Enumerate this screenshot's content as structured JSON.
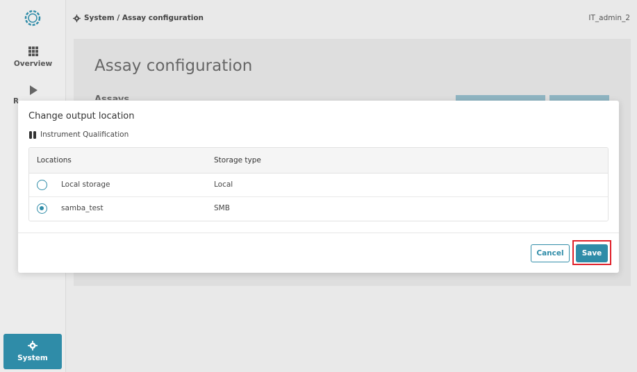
{
  "sidebar": {
    "items": [
      {
        "label": "Overview",
        "icon": "grid-icon"
      },
      {
        "label": "R",
        "icon": "play-icon"
      },
      {
        "label": "System",
        "icon": "gear-icon"
      }
    ]
  },
  "header": {
    "breadcrumb": "System / Assay configuration",
    "user": "IT_admin_2"
  },
  "page": {
    "title": "Assay configuration",
    "subtitle": "Assays"
  },
  "modal": {
    "title": "Change output location",
    "subtitle": "Instrument Qualification",
    "columns": [
      "Locations",
      "Storage type"
    ],
    "rows": [
      {
        "location": "Local storage",
        "storage_type": "Local",
        "selected": false
      },
      {
        "location": "samba_test",
        "storage_type": "SMB",
        "selected": true
      }
    ],
    "cancel_label": "Cancel",
    "save_label": "Save"
  },
  "colors": {
    "accent": "#2f8ca8",
    "highlight": "#e0202a"
  }
}
